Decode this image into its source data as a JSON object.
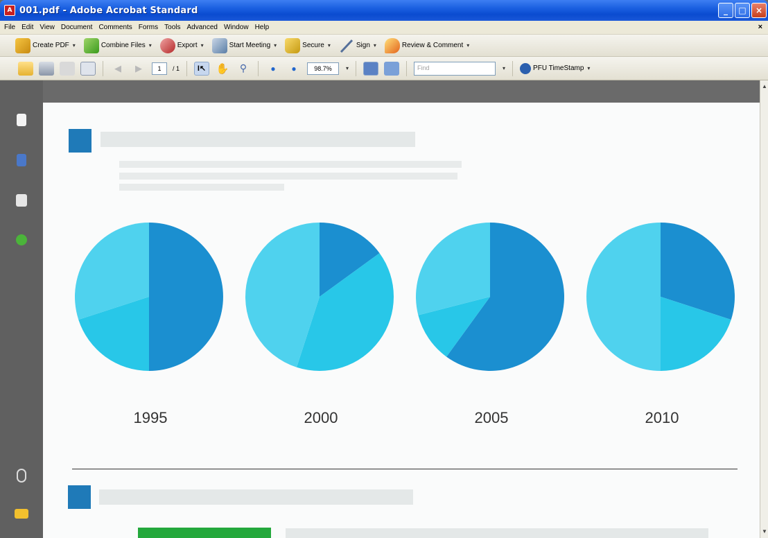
{
  "window": {
    "title": "001.pdf - Adobe Acrobat Standard",
    "buttons": {
      "minimize": "_",
      "maximize": "□",
      "close": "×"
    }
  },
  "menu": {
    "items": [
      "File",
      "Edit",
      "View",
      "Document",
      "Comments",
      "Forms",
      "Tools",
      "Advanced",
      "Window",
      "Help"
    ],
    "close_glyph": "×"
  },
  "tasks_toolbar": {
    "create_pdf": "Create PDF",
    "combine_files": "Combine Files",
    "export": "Export",
    "start_meeting": "Start Meeting",
    "secure": "Secure",
    "sign": "Sign",
    "review_comment": "Review & Comment",
    "dropdown_caret": "▾"
  },
  "file_toolbar": {
    "current_page": "1",
    "page_total": "/ 1",
    "zoom": "98.7%",
    "find_placeholder": "Find",
    "timestamp_label": "PFU TimeStamp",
    "dropdown_caret": "▾"
  },
  "icons": {
    "open": "folder-open-icon",
    "print": "printer-icon",
    "save": "floppy-disk-icon",
    "email": "envelope-icon",
    "prev_page": "arrow-left-icon",
    "next_page": "arrow-right-icon",
    "select": "select-text-cursor-icon",
    "hand": "hand-icon",
    "zoom": "zoom-marquee-icon",
    "zoom_out": "zoom-out-icon",
    "zoom_in": "zoom-in-icon",
    "fit_page": "fit-page-icon",
    "fit_width": "fit-width-icon",
    "nav_pages": "pages-icon",
    "nav_bookmarks": "bookmarks-icon",
    "nav_signatures": "signature-pen-icon",
    "nav_help": "help-question-icon",
    "nav_attachments": "paperclip-icon",
    "nav_comments": "comments-icon"
  },
  "colors": {
    "title_bar": "#1a5fe0",
    "chrome": "#ece9d8",
    "nav_pane": "#606060",
    "page": "#fafbfb",
    "heading_square": "#1f7ab8"
  },
  "chart_data": {
    "type": "pie",
    "title": "",
    "pies": [
      {
        "label": "1995",
        "slices": [
          {
            "value": 50,
            "color": "#1b8fd0"
          },
          {
            "value": 20,
            "color": "#28c7e8"
          },
          {
            "value": 30,
            "color": "#4fd2ee"
          }
        ]
      },
      {
        "label": "2000",
        "slices": [
          {
            "value": 15,
            "color": "#1b8fd0"
          },
          {
            "value": 40,
            "color": "#28c7e8"
          },
          {
            "value": 45,
            "color": "#4fd2ee"
          }
        ]
      },
      {
        "label": "2005",
        "slices": [
          {
            "value": 60,
            "color": "#1b8fd0"
          },
          {
            "value": 11,
            "color": "#28c7e8"
          },
          {
            "value": 29,
            "color": "#4fd2ee"
          }
        ]
      },
      {
        "label": "2010",
        "slices": [
          {
            "value": 30,
            "color": "#1b8fd0"
          },
          {
            "value": 20,
            "color": "#28c7e8"
          },
          {
            "value": 50,
            "color": "#4fd2ee"
          }
        ]
      }
    ]
  }
}
